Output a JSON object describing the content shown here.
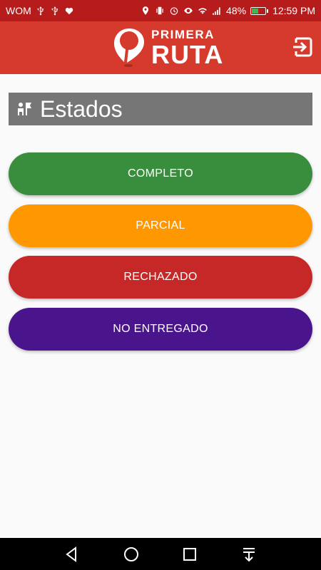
{
  "status_bar": {
    "carrier": "WOM",
    "battery_percent": "48%",
    "battery_level": 0.48,
    "time": "12:59 PM",
    "icons_left": [
      "usb-icon",
      "usb-icon",
      "heart-rate-icon"
    ],
    "icons_right": [
      "location-icon",
      "vibrate-icon",
      "alarm-icon",
      "eye-icon",
      "wifi-icon",
      "signal-icon",
      "battery-icon"
    ]
  },
  "app_bar": {
    "logo_top": "PRIMERA",
    "logo_bottom": "RUTA",
    "logout_icon": "logout-icon"
  },
  "section": {
    "title": "Estados",
    "icon": "people-flag-icon"
  },
  "states": [
    {
      "label": "COMPLETO",
      "color": "#388e3c"
    },
    {
      "label": "PARCIAL",
      "color": "#ff9800"
    },
    {
      "label": "RECHAZADO",
      "color": "#c62828"
    },
    {
      "label": "NO ENTREGADO",
      "color": "#4a148c"
    }
  ],
  "colors": {
    "status_bar": "#b71c1c",
    "app_bar": "#d63a2d",
    "section_header": "#767676"
  },
  "nav_bar": {
    "icons": [
      "back-icon",
      "home-icon",
      "recents-icon",
      "notifications-pull-icon"
    ]
  }
}
